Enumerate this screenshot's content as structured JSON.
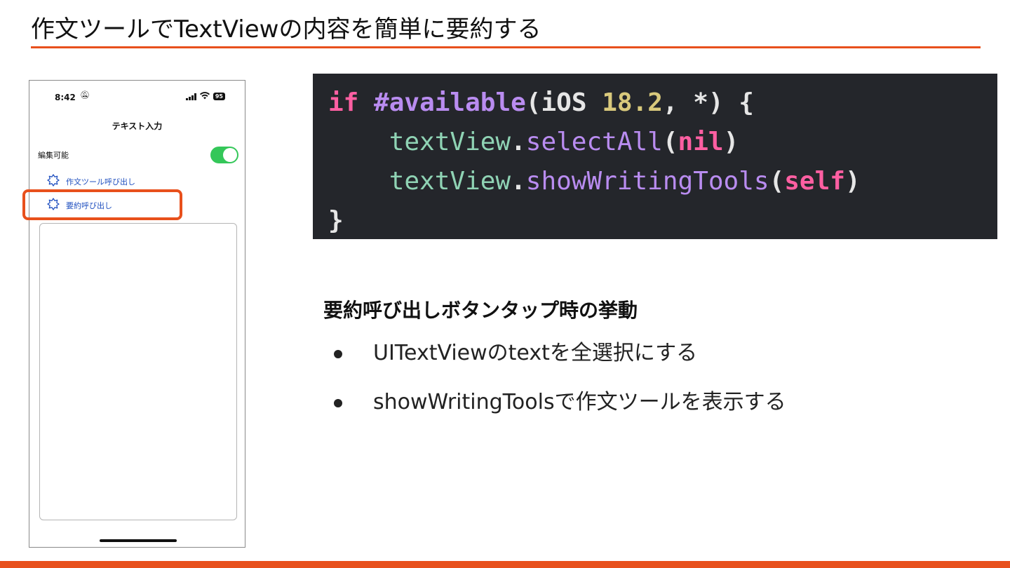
{
  "slide": {
    "title": "作文ツールでTextViewの内容を簡単に要約する",
    "accent_color": "#e8501c"
  },
  "phone": {
    "status_time": "8:42",
    "battery": "95",
    "nav_title": "テキスト入力",
    "edit_label": "編集可能",
    "toggle_on": true,
    "menu_items": [
      {
        "label": "作文ツール呼び出し",
        "icon": "writing-tools-icon"
      },
      {
        "label": "要約呼び出し",
        "icon": "writing-tools-icon",
        "highlighted": true
      }
    ],
    "toggle_color": "#34c759"
  },
  "code": {
    "lines": [
      "if #available(iOS 18.2, *) {",
      "    textView.selectAll(nil)",
      "    textView.showWritingTools(self)",
      "}"
    ]
  },
  "section": {
    "heading": "要約呼び出しボタンタップ時の挙動",
    "bullets": [
      "UITextViewのtextを全選択にする",
      "showWritingToolsで作文ツールを表示する"
    ]
  }
}
